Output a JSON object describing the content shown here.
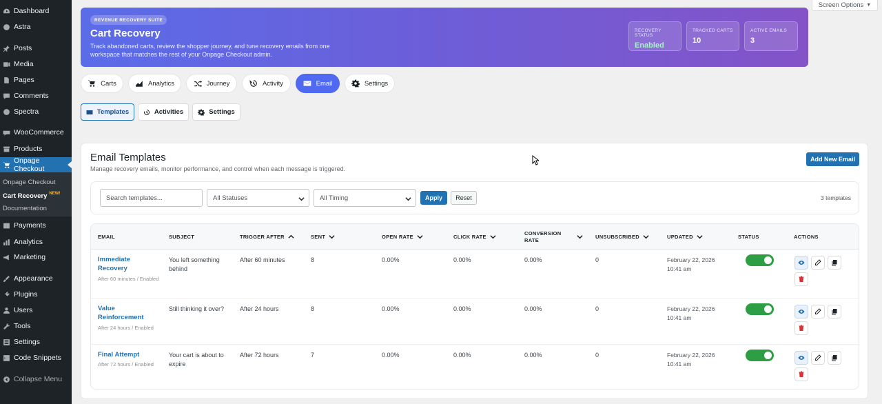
{
  "screen_options": "Screen Options",
  "sidebar": {
    "items": [
      {
        "label": "Dashboard",
        "icon": "dashboard-icon"
      },
      {
        "label": "Astra",
        "icon": "astra-icon"
      },
      {
        "label": "Posts",
        "icon": "pushpin-icon"
      },
      {
        "label": "Media",
        "icon": "media-icon"
      },
      {
        "label": "Pages",
        "icon": "page-icon"
      },
      {
        "label": "Comments",
        "icon": "comment-icon"
      },
      {
        "label": "Spectra",
        "icon": "spectra-icon"
      },
      {
        "label": "WooCommerce",
        "icon": "woocommerce-icon"
      },
      {
        "label": "Products",
        "icon": "archive-icon"
      },
      {
        "label": "Onpage Checkout",
        "icon": "cart-icon"
      },
      {
        "label": "Payments",
        "icon": "dollar-icon"
      },
      {
        "label": "Analytics",
        "icon": "bar-chart-icon"
      },
      {
        "label": "Marketing",
        "icon": "megaphone-icon"
      },
      {
        "label": "Appearance",
        "icon": "brush-icon"
      },
      {
        "label": "Plugins",
        "icon": "plug-icon"
      },
      {
        "label": "Users",
        "icon": "users-icon"
      },
      {
        "label": "Tools",
        "icon": "wrench-icon"
      },
      {
        "label": "Settings",
        "icon": "settings-icon"
      },
      {
        "label": "Code Snippets",
        "icon": "code-icon"
      },
      {
        "label": "Collapse Menu",
        "icon": "collapse-icon"
      }
    ],
    "submenu": [
      {
        "label": "Onpage Checkout"
      },
      {
        "label": "Cart Recovery",
        "badge": "NEW!"
      },
      {
        "label": "Documentation"
      }
    ]
  },
  "hero": {
    "badge": "REVENUE RECOVERY SUITE",
    "title": "Cart Recovery",
    "description": "Track abandoned carts, review the shopper journey, and tune recovery emails from one workspace that matches the rest of your Onpage Checkout admin.",
    "stats": [
      {
        "label": "RECOVERY STATUS",
        "value": "Enabled"
      },
      {
        "label": "TRACKED CARTS",
        "value": "10"
      },
      {
        "label": "ACTIVE EMAILS",
        "value": "3"
      }
    ]
  },
  "tabs": [
    {
      "label": "Carts",
      "icon": "cart-icon"
    },
    {
      "label": "Analytics",
      "icon": "chart-icon"
    },
    {
      "label": "Journey",
      "icon": "shuffle-icon"
    },
    {
      "label": "Activity",
      "icon": "history-icon"
    },
    {
      "label": "Email",
      "icon": "envelope-icon"
    },
    {
      "label": "Settings",
      "icon": "gear-icon"
    }
  ],
  "subtabs": [
    {
      "label": "Templates",
      "icon": "envelope-icon"
    },
    {
      "label": "Activities",
      "icon": "history-icon"
    },
    {
      "label": "Settings",
      "icon": "gear-icon"
    }
  ],
  "card": {
    "title": "Email Templates",
    "description": "Manage recovery emails, monitor performance, and control when each message is triggered.",
    "add_button": "Add New Email"
  },
  "filters": {
    "search_placeholder": "Search templates...",
    "status": "All Statuses",
    "timing": "All Timing",
    "apply": "Apply",
    "reset": "Reset",
    "count": "3 templates"
  },
  "table": {
    "headers": [
      "EMAIL",
      "SUBJECT",
      "TRIGGER AFTER",
      "SENT",
      "OPEN RATE",
      "CLICK RATE",
      "CONVERSION RATE",
      "UNSUBSCRIBED",
      "UPDATED",
      "STATUS",
      "ACTIONS"
    ],
    "rows": [
      {
        "name": "Immediate Recovery",
        "meta": "After 60 minutes / Enabled",
        "subject": "You left something behind",
        "trigger": "After 60 minutes",
        "sent": "8",
        "open": "0.00%",
        "click": "0.00%",
        "conversion": "0.00%",
        "unsub": "0",
        "date": "February 22, 2026",
        "time": "10:41 am",
        "status": true
      },
      {
        "name": "Value Reinforcement",
        "meta": "After 24 hours / Enabled",
        "subject": "Still thinking it over?",
        "trigger": "After 24 hours",
        "sent": "8",
        "open": "0.00%",
        "click": "0.00%",
        "conversion": "0.00%",
        "unsub": "0",
        "date": "February 22, 2026",
        "time": "10:41 am",
        "status": true
      },
      {
        "name": "Final Attempt",
        "meta": "After 72 hours / Enabled",
        "subject": "Your cart is about to expire",
        "trigger": "After 72 hours",
        "sent": "7",
        "open": "0.00%",
        "click": "0.00%",
        "conversion": "0.00%",
        "unsub": "0",
        "date": "February 22, 2026",
        "time": "10:41 am",
        "status": true
      }
    ]
  },
  "colors": {
    "accent": "#2271b1",
    "tab_active": "#4f6af0",
    "toggle_on": "#2e9e44",
    "delete": "#d63638",
    "sidebar_bg": "#1d2327"
  }
}
